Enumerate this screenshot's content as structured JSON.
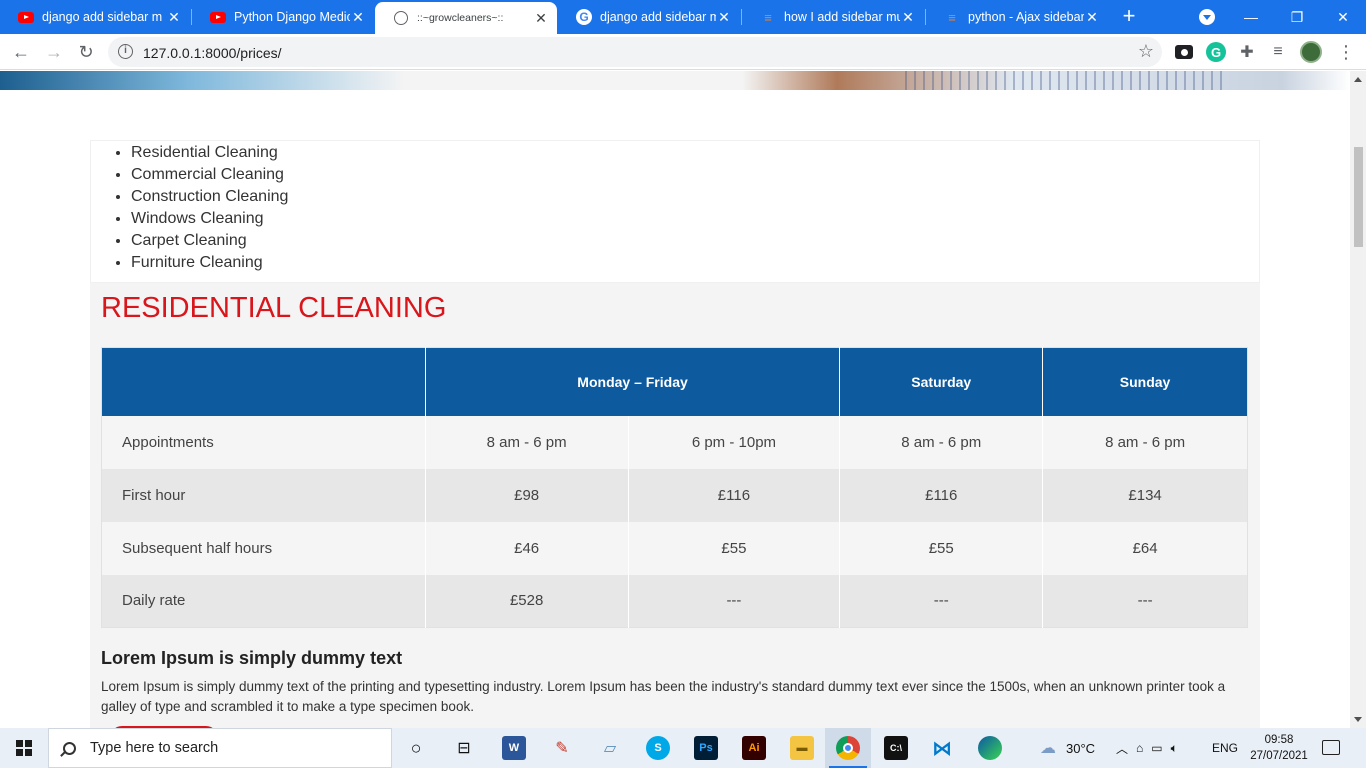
{
  "browser": {
    "tabs": [
      {
        "title": "django add sidebar m",
        "favicon": "youtube-icon"
      },
      {
        "title": "Python Django Medica",
        "favicon": "youtube-icon"
      },
      {
        "title": "::~growcleaners~::",
        "favicon": "globe-icon",
        "active": true
      },
      {
        "title": "django add sidebar m",
        "favicon": "google-icon"
      },
      {
        "title": "how I add sidebar mul",
        "favicon": "stackoverflow-icon"
      },
      {
        "title": "python - Ajax sidebar",
        "favicon": "stackoverflow-icon"
      }
    ],
    "new_tab": "+",
    "url": "127.0.0.1:8000/prices/",
    "accent": "#1a73e8"
  },
  "page": {
    "services": [
      "Residential Cleaning",
      "Commercial Cleaning",
      "Construction Cleaning",
      "Windows Cleaning",
      "Carpet Cleaning",
      "Furniture Cleaning"
    ],
    "section_title": "RESIDENTIAL CLEANING",
    "table": {
      "headers": [
        "",
        "Monday – Friday",
        "Saturday",
        "Sunday"
      ],
      "rows": [
        [
          "Appointments",
          "8 am - 6 pm",
          "6 pm - 10pm",
          "8 am - 6 pm",
          "8 am - 6 pm"
        ],
        [
          "First hour",
          "£98",
          "£116",
          "£116",
          "£134"
        ],
        [
          "Subsequent half hours",
          "£46",
          "£55",
          "£55",
          "£64"
        ],
        [
          "Daily rate",
          "£528",
          "---",
          "---",
          "---"
        ]
      ],
      "header_color": "#0d5b9e"
    },
    "lorem_title": "Lorem Ipsum is simply dummy text",
    "lorem_text": "Lorem Ipsum is simply dummy text of the printing and typesetting industry. Lorem Ipsum has been the industry's standard dummy text ever since the 1500s, when an unknown printer took a galley of type and scrambled it to make a type specimen book.",
    "title_color": "#d8161b"
  },
  "taskbar": {
    "search_placeholder": "Type here to search",
    "weather": "30°C",
    "language": "ENG",
    "time": "09:58",
    "date": "27/07/2021"
  }
}
